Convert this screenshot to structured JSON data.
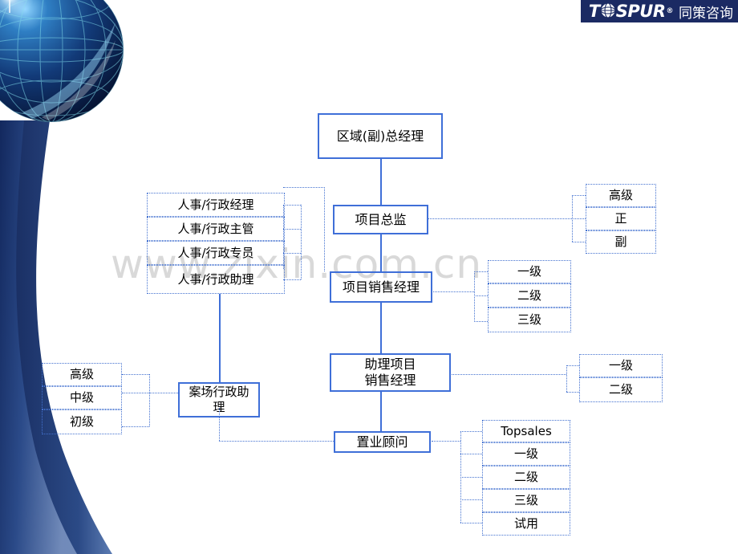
{
  "logo": {
    "brand_main": "T",
    "brand_rest": "SPUR",
    "registered": "®",
    "brand_cn": "同策咨询",
    "globe_icon": "globe-icon"
  },
  "watermark": {
    "text": "www.zixin.com.cn"
  },
  "colors": {
    "accent_blue": "#3f6fd8",
    "dotted_blue": "#4472d0",
    "banner_navy": "#1b2a63",
    "watermark_gray": "#d9d9d9"
  },
  "org_chart": {
    "top": {
      "label": "区域(副)总经理"
    },
    "hr_group": [
      {
        "label": "人事/行政经理"
      },
      {
        "label": "人事/行政主管"
      },
      {
        "label": "人事/行政专员"
      },
      {
        "label": "人事/行政助理"
      }
    ],
    "spine": [
      {
        "label": "项目总监"
      },
      {
        "label": "项目销售经理"
      },
      {
        "label_line1": "助理项目",
        "label_line2": "销售经理"
      },
      {
        "label": "置业顾问"
      }
    ],
    "director_grades": [
      {
        "label": "高级"
      },
      {
        "label": "正"
      },
      {
        "label": "副"
      }
    ],
    "sales_manager_grades": [
      {
        "label": "一级"
      },
      {
        "label": "二级"
      },
      {
        "label": "三级"
      }
    ],
    "assistant_manager_grades": [
      {
        "label": "一级"
      },
      {
        "label": "二级"
      }
    ],
    "consultant_grades": [
      {
        "label": "Topsales"
      },
      {
        "label": "一级"
      },
      {
        "label": "二级"
      },
      {
        "label": "三级"
      },
      {
        "label": "试用"
      }
    ],
    "site_admin": {
      "label_line1": "案场行政助",
      "label_line2": "理"
    },
    "site_admin_grades": [
      {
        "label": "高级"
      },
      {
        "label": "中级"
      },
      {
        "label": "初级"
      }
    ]
  }
}
